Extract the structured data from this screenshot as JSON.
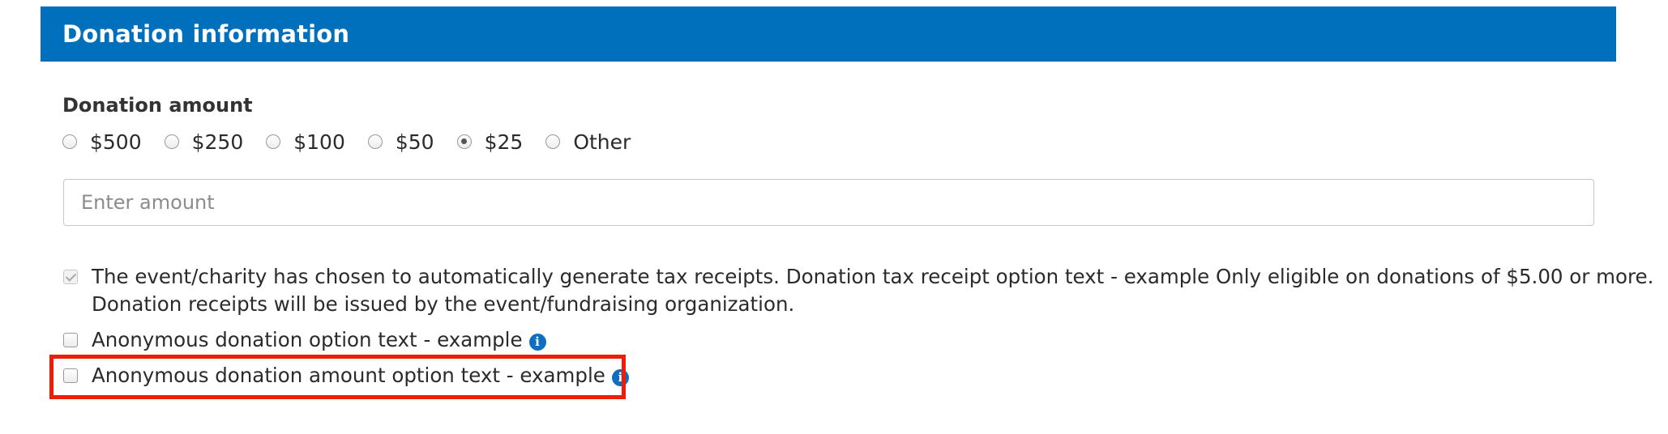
{
  "header": {
    "title": "Donation information"
  },
  "donation_amount": {
    "label": "Donation amount",
    "options": [
      "$500",
      "$250",
      "$100",
      "$50",
      "$25",
      "Other"
    ],
    "selected": "$25"
  },
  "amount_input": {
    "placeholder": "Enter amount",
    "value": ""
  },
  "checkboxes": {
    "tax_receipt": {
      "line1": "The event/charity has chosen to automatically generate tax receipts. Donation tax receipt option text - example Only eligible on donations of $5.00 or more.",
      "line2": "Donation receipts will be issued by the event/fundraising organization.",
      "checked": true,
      "disabled": true
    },
    "anonymous_donation": {
      "label": "Anonymous donation option text - example",
      "checked": false
    },
    "anonymous_amount": {
      "label": "Anonymous donation amount option text - example",
      "checked": false
    }
  },
  "icons": {
    "info": "info-icon",
    "info_glyph": "i"
  },
  "colors": {
    "header_bg": "#0070bd",
    "info_icon": "#0e6fc0",
    "highlight": "#ee1c0a"
  }
}
